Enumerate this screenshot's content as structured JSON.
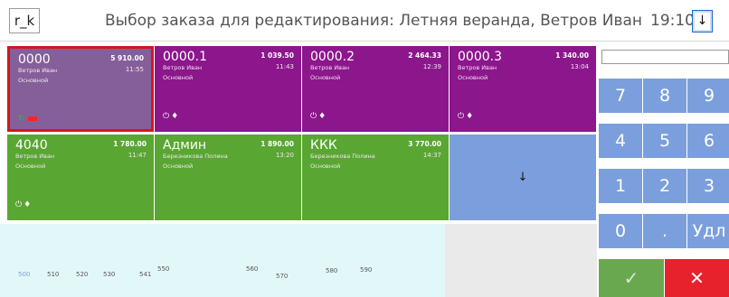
{
  "header": {
    "app_name": "r_k",
    "title": "Выбор заказа для редактирования: Летняя веранда, Ветров Иван",
    "clock": "19:10",
    "menu_icon": "↓"
  },
  "orders": [
    {
      "name": "0000",
      "sum": "5 910.00",
      "waiter": "Ветров Иван",
      "time": "11:55",
      "menu": "Основной",
      "color": "purple",
      "selected": true
    },
    {
      "name": "0000.1",
      "sum": "1 039.50",
      "waiter": "Ветров Иван",
      "time": "11:43",
      "menu": "Основной",
      "color": "purple",
      "selected": false
    },
    {
      "name": "0000.2",
      "sum": "2 464.33",
      "waiter": "Ветров Иван",
      "time": "12:39",
      "menu": "Основной",
      "color": "purple",
      "selected": false
    },
    {
      "name": "0000.3",
      "sum": "1 340.00",
      "waiter": "Ветров Иван",
      "time": "13:04",
      "menu": "Основной",
      "color": "purple",
      "selected": false
    },
    {
      "name": "4040",
      "sum": "1 780.00",
      "waiter": "Ветров Иван",
      "time": "11:47",
      "menu": "Основной",
      "color": "green",
      "selected": false
    },
    {
      "name": "Админ",
      "sum": "1 890.00",
      "waiter": "Березникова Полина",
      "time": "13:20",
      "menu": "Основной",
      "color": "green",
      "selected": false
    },
    {
      "name": "ККК",
      "sum": "3 770.00",
      "waiter": "Березникова Полина",
      "time": "14:37",
      "menu": "Основной",
      "color": "green",
      "selected": false
    }
  ],
  "scroll_down_icon": "↓",
  "tables": [
    "500",
    "510",
    "520",
    "530",
    "541",
    "550",
    "560",
    "570",
    "580",
    "590"
  ],
  "keypad": {
    "input_value": "",
    "keys": [
      "7",
      "8",
      "9",
      "4",
      "5",
      "6",
      "1",
      "2",
      "3",
      "0",
      ".",
      "Удл"
    ],
    "ok_icon": "✓",
    "cancel_icon": "✕"
  },
  "colors": {
    "purple": "#8c168c",
    "green": "#5aa632",
    "selected_bg": "#845f9a",
    "selected_border": "#d2161e",
    "key_blue": "#7a9fdc",
    "ok_green": "#6aa84f",
    "cancel_red": "#e8222c",
    "tables_bg": "#e2f8f8"
  }
}
